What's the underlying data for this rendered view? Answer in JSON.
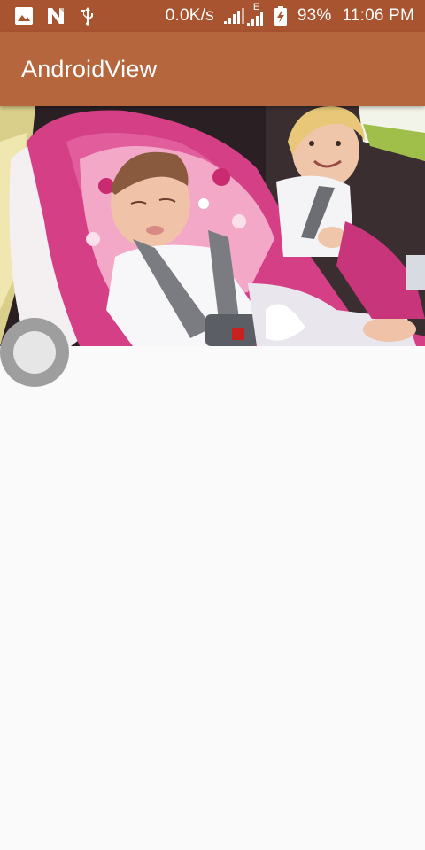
{
  "status_bar": {
    "network_speed": "0.0K/s",
    "network_type": "E",
    "battery_percent": "93%",
    "time": "11:06 PM",
    "icons": [
      "image-icon",
      "n-notification-icon",
      "usb-icon",
      "signal-icon",
      "signal-icon",
      "battery-charging-icon"
    ],
    "background_color": "#a95430"
  },
  "app_bar": {
    "title": "AndroidView",
    "background_color": "#b5663d"
  },
  "video": {
    "content": "video-frame"
  },
  "seek_bar": {
    "thumb_color": "#9e9e9e",
    "progress": 0
  },
  "page_background": "#fafafa"
}
